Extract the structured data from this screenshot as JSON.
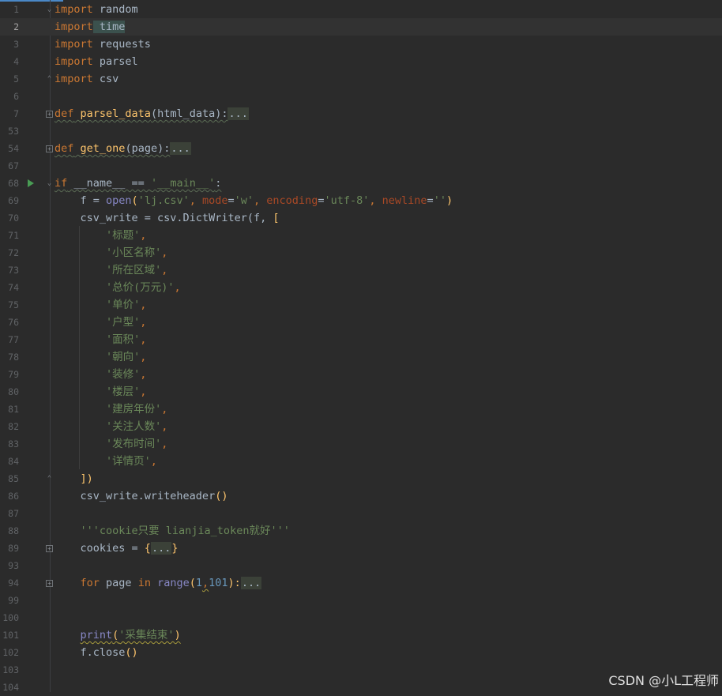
{
  "editor": {
    "colors": {
      "background": "#2b2b2b",
      "keyword": "#cc7832",
      "function": "#ffc66d",
      "string": "#6a8759",
      "number": "#6897bb",
      "param": "#aa4926",
      "builtin": "#8888c6",
      "text": "#a9b7c6"
    },
    "lines": [
      {
        "num": "1",
        "kw": "import",
        "rest": " random"
      },
      {
        "num": "2",
        "kw": "import",
        "rest": " time"
      },
      {
        "num": "3",
        "kw": "import",
        "rest": " requests"
      },
      {
        "num": "4",
        "kw": "import",
        "rest": " parsel"
      },
      {
        "num": "5",
        "kw": "import",
        "rest": " csv"
      },
      {
        "num": "6"
      },
      {
        "num": "7",
        "kw": "def",
        "name": "parsel_data",
        "args": "(html_data):",
        "folded": "..."
      },
      {
        "num": "53"
      },
      {
        "num": "54",
        "kw": "def",
        "name": "get_one",
        "args": "(page):",
        "folded": "..."
      },
      {
        "num": "67"
      },
      {
        "num": "68",
        "kw": "if",
        "rest": " __name__ == ",
        "str": "'__main__'",
        "tail": ":"
      },
      {
        "num": "69",
        "a": "    f = ",
        "b": "open",
        "c": "(",
        "s1": "'lj.csv'",
        "c2": ", ",
        "p1": "mode",
        "c3": "=",
        "s2": "'w'",
        "c4": ", ",
        "p2": "encoding",
        "c5": "=",
        "s3": "'utf-8'",
        "c6": ", ",
        "p3": "newline",
        "c7": "=",
        "s4": "''",
        "c8": ")"
      },
      {
        "num": "70",
        "a": "    csv_write = csv.DictWriter(f, ",
        "bracket": "["
      },
      {
        "num": "71",
        "item": "'标题'"
      },
      {
        "num": "72",
        "item": "'小区名称'"
      },
      {
        "num": "73",
        "item": "'所在区域'"
      },
      {
        "num": "74",
        "item": "'总价(万元)'"
      },
      {
        "num": "75",
        "item": "'单价'"
      },
      {
        "num": "76",
        "item": "'户型'"
      },
      {
        "num": "77",
        "item": "'面积'"
      },
      {
        "num": "78",
        "item": "'朝向'"
      },
      {
        "num": "79",
        "item": "'装修'"
      },
      {
        "num": "80",
        "item": "'楼层'"
      },
      {
        "num": "81",
        "item": "'建房年份'"
      },
      {
        "num": "82",
        "item": "'关注人数'"
      },
      {
        "num": "83",
        "item": "'发布时间'"
      },
      {
        "num": "84",
        "item": "'详情页'"
      },
      {
        "num": "85",
        "a": "    ",
        "bracket": "])"
      },
      {
        "num": "86",
        "a": "    csv_write.writeheader",
        "bracket": "()"
      },
      {
        "num": "87"
      },
      {
        "num": "88",
        "doc": "    '''cookie只要 lianjia_token就好'''"
      },
      {
        "num": "89",
        "a": "    cookies = ",
        "b1": "{",
        "folded": "...",
        "b2": "}"
      },
      {
        "num": "93"
      },
      {
        "num": "94",
        "kw": "for",
        "for_var": " page ",
        "in": "in",
        "range": "range",
        "r1": "(",
        "n1": "1",
        "comma": ",",
        "n2": "101",
        "r2": "):",
        "folded": "..."
      },
      {
        "num": "99"
      },
      {
        "num": "100"
      },
      {
        "num": "101",
        "print": "print",
        "pp1": "(",
        "pstr": "'采集结束'",
        "pp2": ")"
      },
      {
        "num": "102",
        "a": "    f.close",
        "bracket": "()"
      },
      {
        "num": "103"
      },
      {
        "num": "104"
      }
    ]
  },
  "watermark": "CSDN @小L工程师"
}
